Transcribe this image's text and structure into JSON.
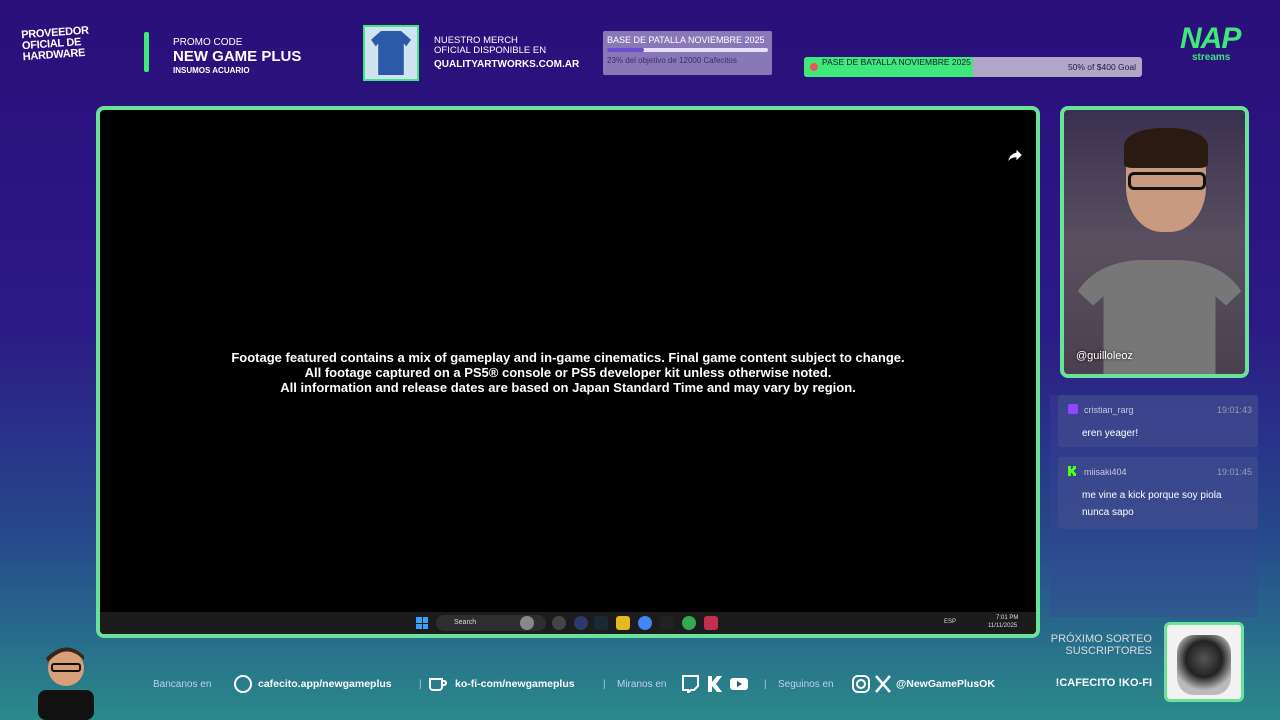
{
  "top": {
    "sponsor": "PROVEEDOR OFICIAL DE HARDWARE",
    "promo_label": "PROMO CODE",
    "promo_code": "NEW GAME PLUS",
    "promo_sub": "INSUMOS ACUARIO",
    "merch_line1": "NUESTRO MERCH",
    "merch_line2": "OFICIAL DISPONIBLE EN",
    "merch_url": "QUALITYARTWORKS.COM.AR",
    "goal1_title": "BASE DE PATALLA NOVIEMBRE 2025",
    "goal1_status": "23% del objetivo de 12000 Cafecitos",
    "goal1_progress": 0.23,
    "goal2_title": "PASE DE BATALLA NOVIEMBRE 2025",
    "goal2_amount": "50% of $400 Goal",
    "goal2_progress": 0.5,
    "brand": "NAP",
    "brand_sub": "streams"
  },
  "video": {
    "disclaimer_1": "Footage featured contains a mix of gameplay and in-game cinematics. Final game content subject to change.",
    "disclaimer_2": "All footage captured on a PS5® console or PS5 developer kit unless otherwise noted.",
    "disclaimer_3": "All information and release dates are based on Japan Standard Time and may vary by region.",
    "taskbar": {
      "search": "Search",
      "lang": "ESP",
      "time": "7:01 PM",
      "date": "11/11/2025"
    }
  },
  "cam": {
    "handle": "@guilloleoz"
  },
  "chat": [
    {
      "user": "cristian_rarg",
      "time": "19:01:43",
      "text": "eren yeager!",
      "platform": "twitch"
    },
    {
      "user": "miisaki404",
      "time": "19:01:45",
      "text": "me vine a kick porque soy piola nunca sapo",
      "platform": "kick"
    }
  ],
  "bottom": {
    "bancanos": "Bancanos en",
    "cafecito": "cafecito.app/newgameplus",
    "kofi": "ko-fi-com/newgameplus",
    "miranos": "Miranos en",
    "seguinos": "Seguinos en",
    "handle": "@NewGamePlusOK",
    "sep": "|",
    "giveaway": "PRÓXIMO SORTEO SUSCRIPTORES",
    "commands": "!CAFECITO !KO-FI"
  },
  "colors": {
    "accent": "#6be29a",
    "green": "#3ee87a",
    "bg_top": "#2a0f7a"
  }
}
